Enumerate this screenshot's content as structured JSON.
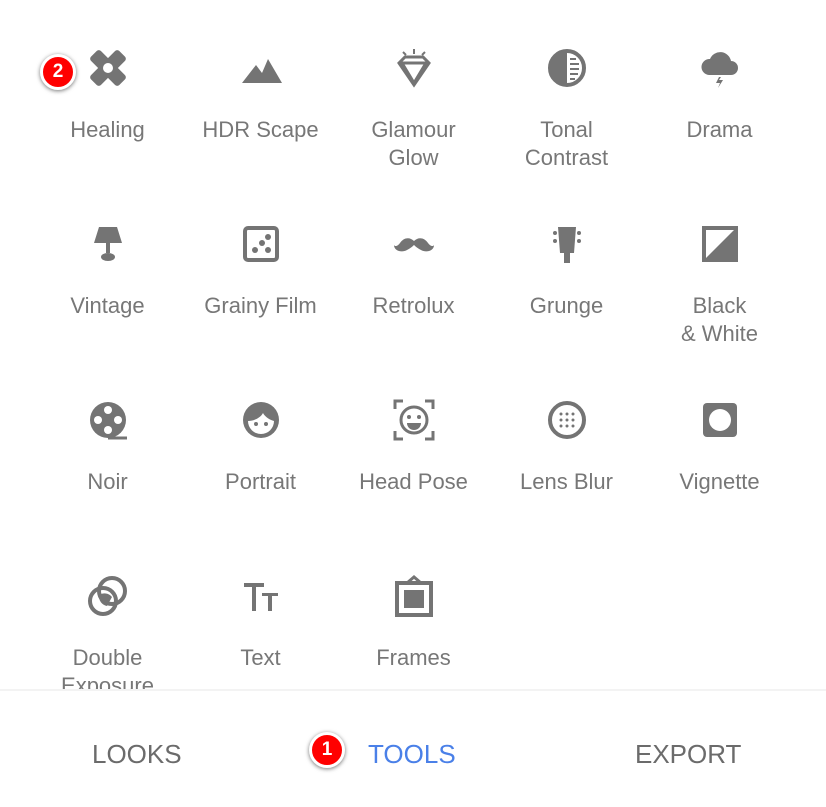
{
  "tools": [
    {
      "label": "Healing",
      "icon": "bandage-icon"
    },
    {
      "label": "HDR Scape",
      "icon": "mountains-icon"
    },
    {
      "label": "Glamour\nGlow",
      "icon": "diamond-icon"
    },
    {
      "label": "Tonal\nContrast",
      "icon": "tonal-contrast-icon"
    },
    {
      "label": "Drama",
      "icon": "storm-cloud-icon"
    },
    {
      "label": "Vintage",
      "icon": "lamp-icon"
    },
    {
      "label": "Grainy Film",
      "icon": "dice-icon"
    },
    {
      "label": "Retrolux",
      "icon": "mustache-icon"
    },
    {
      "label": "Grunge",
      "icon": "guitar-head-icon"
    },
    {
      "label": "Black\n& White",
      "icon": "black-white-icon"
    },
    {
      "label": "Noir",
      "icon": "film-reel-icon"
    },
    {
      "label": "Portrait",
      "icon": "face-icon"
    },
    {
      "label": "Head Pose",
      "icon": "face-frame-icon"
    },
    {
      "label": "Lens Blur",
      "icon": "lens-blur-icon"
    },
    {
      "label": "Vignette",
      "icon": "vignette-icon"
    },
    {
      "label": "Double\nExposure",
      "icon": "double-exposure-icon"
    },
    {
      "label": "Text",
      "icon": "text-icon"
    },
    {
      "label": "Frames",
      "icon": "frame-icon"
    }
  ],
  "badges": {
    "healing": "2",
    "tools": "1"
  },
  "tabs": {
    "looks": "LOOKS",
    "tools": "TOOLS",
    "export": "EXPORT"
  },
  "colors": {
    "active_tab": "#4a80e8",
    "inactive_tab": "#6b6b6b",
    "icon": "#747474",
    "badge": "#ff0000"
  }
}
